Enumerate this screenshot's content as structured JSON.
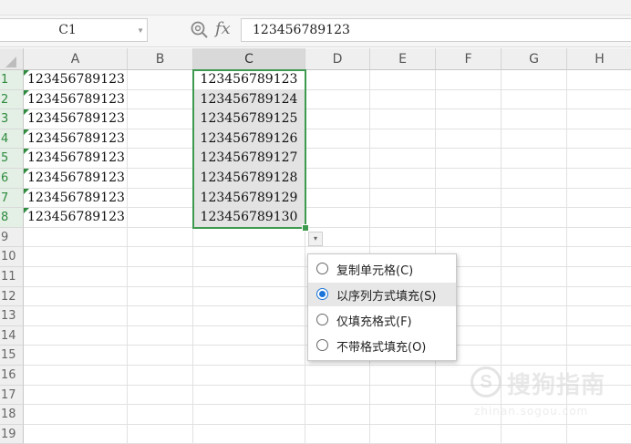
{
  "formula_bar": {
    "name_box_value": "C1",
    "fx_label": "fx",
    "formula_value": "123456789123"
  },
  "columns": [
    "A",
    "B",
    "C",
    "D",
    "E",
    "F",
    "G",
    "H"
  ],
  "rows": [
    "1",
    "2",
    "3",
    "4",
    "5",
    "6",
    "7",
    "8",
    "9",
    "10",
    "11",
    "12",
    "13",
    "14",
    "15",
    "16",
    "17",
    "18",
    "19"
  ],
  "column_a": [
    "123456789123",
    "123456789123",
    "123456789123",
    "123456789123",
    "123456789123",
    "123456789123",
    "123456789123",
    "123456789123"
  ],
  "column_c": [
    "123456789123",
    "123456789124",
    "123456789125",
    "123456789126",
    "123456789127",
    "123456789128",
    "123456789129",
    "123456789130"
  ],
  "selection": {
    "active_cell": "C1",
    "range": "C1:C8"
  },
  "autofill_menu": {
    "options": [
      {
        "label": "复制单元格(C)",
        "checked": false
      },
      {
        "label": "以序列方式填充(S)",
        "checked": true
      },
      {
        "label": "仅填充格式(F)",
        "checked": false
      },
      {
        "label": "不带格式填充(O)",
        "checked": false
      }
    ]
  },
  "watermark": {
    "text": "搜狗指南",
    "url": "zhinan.sogou.com"
  },
  "colors": {
    "selection_border": "#3d9a4f",
    "radio_checked": "#1a73d9",
    "selected_range_fill": "#e3e3e3"
  }
}
